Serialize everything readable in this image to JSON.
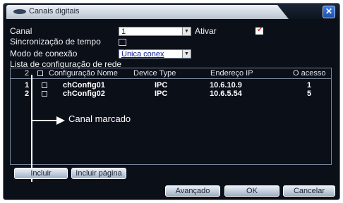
{
  "window": {
    "title": "Canais digitais",
    "close_label": "✕"
  },
  "form": {
    "canal_label": "Canal",
    "canal_value": "1",
    "ativar_label": "Ativar",
    "ativar_checked": true,
    "sync_label": "Sincronização de tempo",
    "sync_checked": false,
    "modo_label": "Modo de conexão",
    "modo_value": "Única conex",
    "lista_label": "Lista de configuração de rede"
  },
  "table": {
    "headers": {
      "num": "2",
      "nome": "Configuração Nome",
      "device": "Device Type",
      "endereco": "Endereço IP",
      "acesso": "O acesso"
    },
    "rows": [
      {
        "num": "1",
        "nome": "chConfig01",
        "device": "IPC",
        "endereco": "10.6.10.9",
        "acesso": "1"
      },
      {
        "num": "2",
        "nome": "chConfig02",
        "device": "IPC",
        "endereco": "10.6.5.54",
        "acesso": "5"
      }
    ]
  },
  "annotation": {
    "text": "Canal marcado"
  },
  "buttons": {
    "incluir": "Incluir",
    "incluir_pagina": "Incluir página",
    "avancado": "Avançado",
    "ok": "OK",
    "cancelar": "Cancelar"
  },
  "colors": {
    "background": "#0a0f18",
    "accent": "#1c4fb0",
    "text": "#f2f2f2"
  }
}
